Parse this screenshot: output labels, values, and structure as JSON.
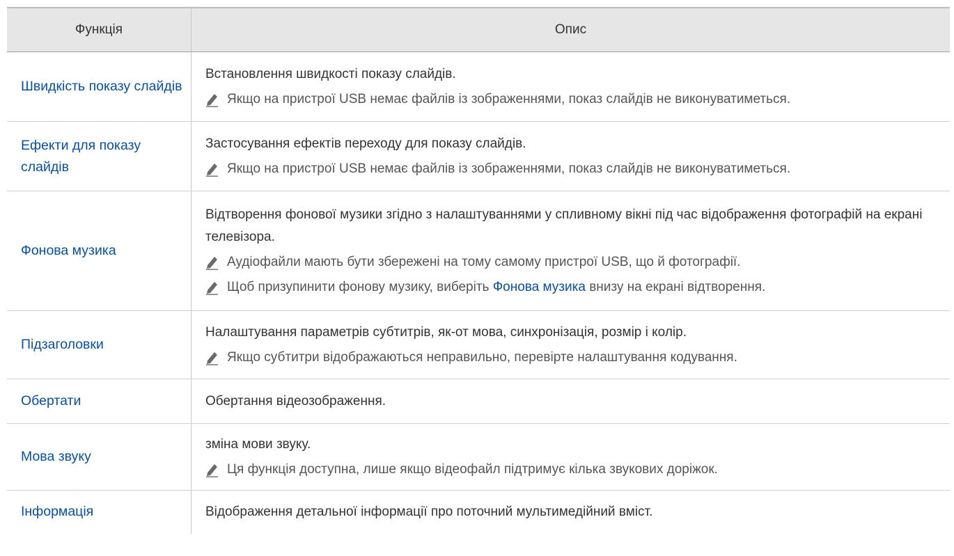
{
  "header": {
    "col_function": "Функція",
    "col_description": "Опис"
  },
  "rows": [
    {
      "function": "Швидкість показу слайдів",
      "description": "Встановлення швидкості показу слайдів.",
      "notes": [
        "Якщо на пристрої USB немає файлів із зображеннями, показ слайдів не виконуватиметься."
      ]
    },
    {
      "function": "Ефекти для показу слайдів",
      "description": "Застосування ефектів переходу для показу слайдів.",
      "notes": [
        "Якщо на пристрої USB немає файлів із зображеннями, показ слайдів не виконуватиметься."
      ]
    },
    {
      "function": "Фонова музика",
      "description": "Відтворення фонової музики згідно з налаштуваннями у спливному вікні під час відображення фотографій на екрані телевізора.",
      "notes": [
        "Аудіофайли мають бути збережені на тому самому пристрої USB, що й фотографії.",
        {
          "before": "Щоб призупинити фонову музику, виберіть ",
          "link": "Фонова музика",
          "after": " внизу на екрані відтворення."
        }
      ]
    },
    {
      "function": "Підзаголовки",
      "description": "Налаштування параметрів субтитрів, як-от мова, синхронізація, розмір і колір.",
      "notes": [
        "Якщо субтитри відображаються неправильно, перевірте налаштування кодування."
      ]
    },
    {
      "function": "Обертати",
      "description": "Обертання відеозображення.",
      "notes": []
    },
    {
      "function": "Мова звуку",
      "description": "зміна мови звуку.",
      "notes": [
        "Ця функція доступна, лише якщо відеофайл підтримує кілька звукових доріжок."
      ]
    },
    {
      "function": "Інформація",
      "description": "Відображення детальної інформації про поточний мультимедійний вміст.",
      "notes": []
    }
  ],
  "icons": {
    "note_icon": "pencil-icon"
  },
  "colors": {
    "link": "#0a4fa1",
    "header_bg": "#e6e6e6"
  }
}
